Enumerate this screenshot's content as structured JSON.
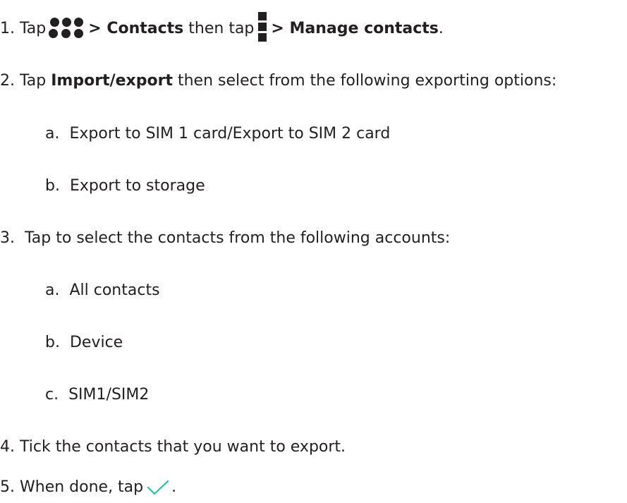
{
  "steps": [
    {
      "num": "1.",
      "tap": "Tap",
      "contacts": "> Contacts",
      "then_tap": "then tap",
      "manage": "> Manage contacts",
      "period": ".",
      "apps_icon": "three-by-two-dots-icon",
      "menu_icon": "vertical-menu-icon"
    },
    {
      "num": "2.",
      "tap": "Tap",
      "import_export": "Import/export",
      "rest": "then select from the following exporting options:",
      "options": [
        {
          "letter": "a.",
          "text": "Export to SIM 1 card/Export to SIM 2 card"
        },
        {
          "letter": "b.",
          "text": "Export to storage"
        }
      ]
    },
    {
      "num": "3.",
      "text": "Tap to select the contacts from the following accounts:",
      "options": [
        {
          "letter": "a.",
          "text": "All contacts"
        },
        {
          "letter": "b.",
          "text": "Device"
        },
        {
          "letter": "c.",
          "text": "SIM1/SIM2"
        }
      ]
    },
    {
      "num": "4.",
      "text": "Tick the contacts that you want to export."
    },
    {
      "num": "5.",
      "text": "When done, tap",
      "period": ".",
      "check_icon": "checkmark-icon",
      "check_color": "#2bbfa4"
    }
  ]
}
